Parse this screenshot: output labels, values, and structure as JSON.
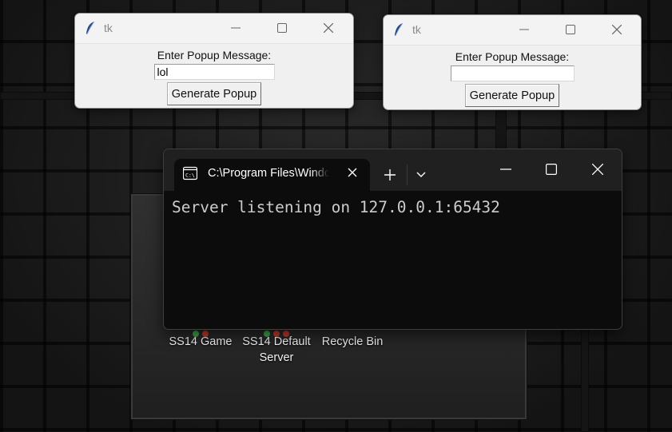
{
  "tk_window_1": {
    "title": "tk",
    "label": "Enter Popup Message:",
    "entry_value": "lol",
    "button": "Generate Popup"
  },
  "tk_window_2": {
    "title": "tk",
    "label": "Enter Popup Message:",
    "entry_value": "",
    "button": "Generate Popup"
  },
  "terminal": {
    "tab_title": "C:\\Program Files\\WindowsApps",
    "output": "Server listening on 127.0.0.1:65432"
  },
  "desktop_icons": [
    {
      "label": "SS14 Game",
      "icon": "ss14-game-icon"
    },
    {
      "label": "SS14 Default Server",
      "icon": "ss14-server-icon"
    },
    {
      "label": "Recycle Bin",
      "icon": "recycle-bin-icon"
    }
  ],
  "colors": {
    "terminal_bg": "#0c0c0c",
    "terminal_text": "#cccccc",
    "tk_bg": "#f0f0f0"
  }
}
